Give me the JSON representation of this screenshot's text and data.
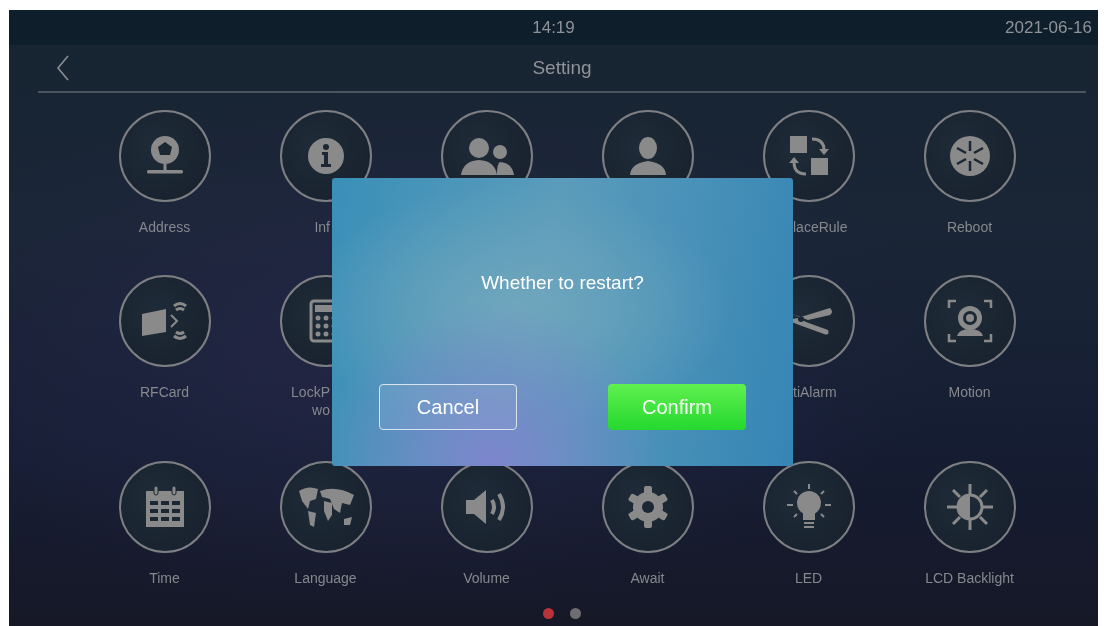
{
  "status_bar": {
    "time": "14:19",
    "date": "2021-06-16"
  },
  "header": {
    "title": "Setting"
  },
  "settings": [
    {
      "label": "Address"
    },
    {
      "label": "Inf"
    },
    {
      "label": "laceRule"
    },
    {
      "label": "Reboot"
    },
    {
      "label": "RFCard"
    },
    {
      "label": "LockP\nwo"
    },
    {
      "label": "tiAlarm"
    },
    {
      "label": "Motion"
    },
    {
      "label": "Time"
    },
    {
      "label": "Language"
    },
    {
      "label": "Volume"
    },
    {
      "label": "Await"
    },
    {
      "label": "LED"
    },
    {
      "label": "LCD Backlight"
    }
  ],
  "pages": [
    {
      "selected": true
    },
    {
      "selected": false
    }
  ],
  "dialog": {
    "message": "Whether to restart?",
    "buttons": [
      {
        "label": "Cancel",
        "kind": "secondary"
      },
      {
        "label": "Confirm",
        "kind": "primary"
      }
    ]
  }
}
